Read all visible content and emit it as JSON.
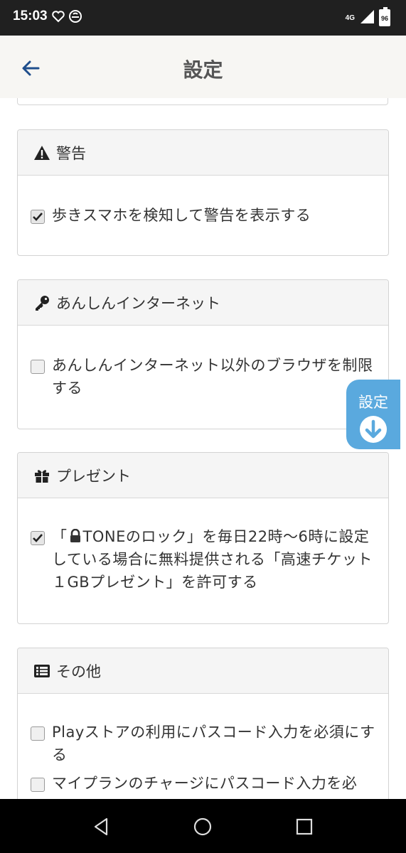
{
  "status_bar": {
    "time": "15:03",
    "network": "4G",
    "battery": "96",
    "icons": [
      "heart-icon",
      "sync-icon",
      "signal-icon",
      "battery-icon"
    ]
  },
  "app_bar": {
    "title": "設定",
    "back_icon": "arrow-left-icon"
  },
  "sections": {
    "warning": {
      "title": "警告",
      "icon": "warning-icon",
      "items": [
        {
          "label": "歩きスマホを検知して警告を表示する",
          "checked": true
        }
      ]
    },
    "safe_internet": {
      "title": "あんしんインターネット",
      "icon": "key-icon",
      "items": [
        {
          "label": "あんしんインターネット以外のブラウザを制限する",
          "checked": false
        }
      ]
    },
    "present": {
      "title": "プレゼント",
      "icon": "gift-icon",
      "items": [
        {
          "label_prefix": "「",
          "label_main": "TONEのロック」を毎日22時〜6時に設定している場合に無料提供される「高速チケット１GBプレゼント」を許可する",
          "checked": true
        }
      ]
    },
    "other": {
      "title": "その他",
      "icon": "list-icon",
      "items": [
        {
          "label": "Playストアの利用にパスコード入力を必須にする",
          "checked": false
        },
        {
          "label": "マイプランのチャージにパスコード入力を必",
          "checked": false
        }
      ]
    }
  },
  "floating_button": {
    "label": "設定",
    "icon": "arrow-down-circle-icon",
    "color": "#5aa9de"
  },
  "nav_bar": {
    "buttons": [
      "back-triangle-icon",
      "home-circle-icon",
      "recents-square-icon"
    ]
  },
  "colors": {
    "accent": "#1f4e8c",
    "header_bg": "#f5f5f5"
  }
}
